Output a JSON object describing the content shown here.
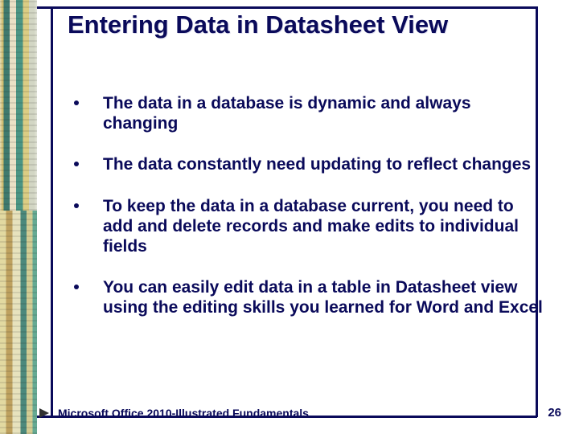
{
  "title": "Entering Data in Datasheet View",
  "bullets": [
    "The data in a database is dynamic and always changing",
    "The data constantly need updating to reflect changes",
    "To keep the data in a database current, you need to add and delete records and make edits to individual fields",
    "You can easily edit data in a table in Datasheet view using the editing skills you learned for Word and Excel"
  ],
  "footer_left": "Microsoft Office 2010-Illustrated Fundamentals",
  "footer_right": "26"
}
